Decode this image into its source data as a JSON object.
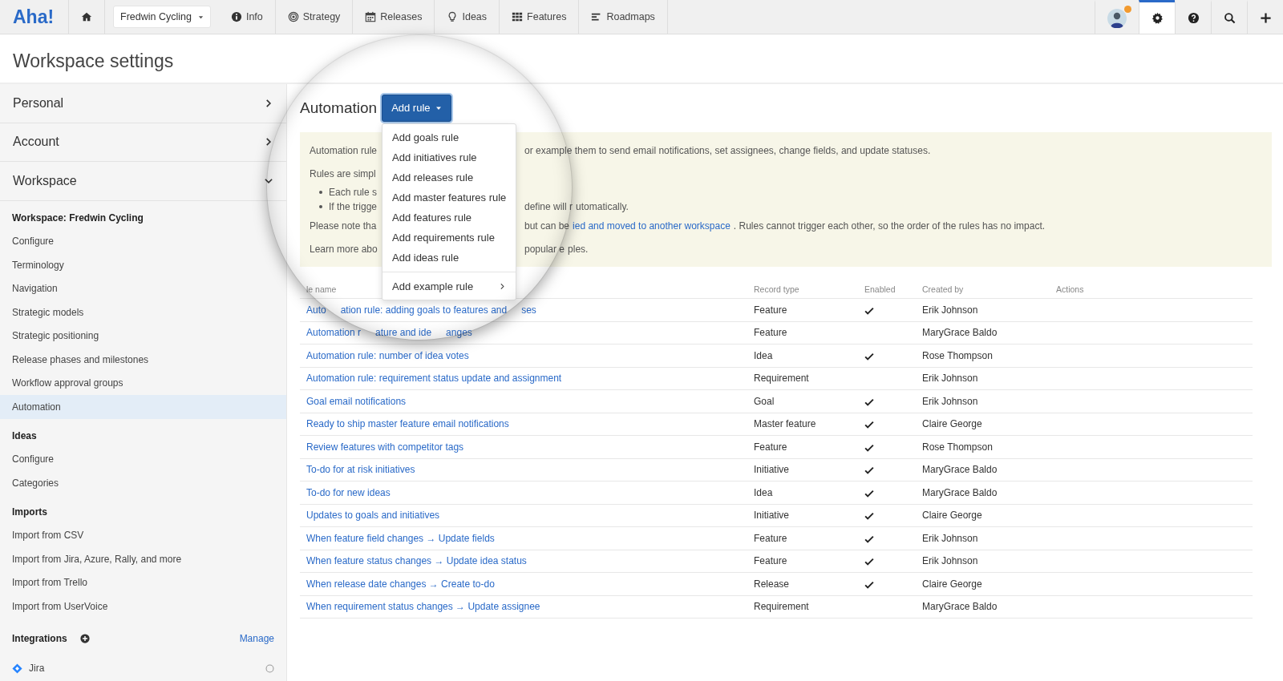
{
  "app": {
    "logo": "Aha!"
  },
  "nav": {
    "workspace_select": "Fredwin Cycling",
    "items": [
      {
        "kind": "home"
      },
      {
        "kind": "info",
        "label": "Info"
      },
      {
        "kind": "strategy",
        "label": "Strategy"
      },
      {
        "kind": "releases",
        "label": "Releases"
      },
      {
        "kind": "ideas",
        "label": "Ideas"
      },
      {
        "kind": "features",
        "label": "Features"
      },
      {
        "kind": "roadmaps",
        "label": "Roadmaps"
      }
    ],
    "tools": [
      {
        "kind": "avatar",
        "selected": false
      },
      {
        "kind": "settings",
        "selected": true
      },
      {
        "kind": "help",
        "selected": false
      },
      {
        "kind": "search",
        "selected": false
      },
      {
        "kind": "add",
        "selected": false
      }
    ]
  },
  "page_title": "Workspace settings",
  "sidebar": {
    "groups": [
      {
        "label": "Personal",
        "expanded": false
      },
      {
        "label": "Account",
        "expanded": false
      },
      {
        "label": "Workspace",
        "expanded": true
      }
    ],
    "sections": [
      {
        "heading": "Workspace: Fredwin Cycling",
        "items": [
          {
            "label": "Configure",
            "selected": false
          },
          {
            "label": "Terminology",
            "selected": false
          },
          {
            "label": "Navigation",
            "selected": false
          },
          {
            "label": "Strategic models",
            "selected": false
          },
          {
            "label": "Strategic positioning",
            "selected": false
          },
          {
            "label": "Release phases and milestones",
            "selected": false
          },
          {
            "label": "Workflow approval groups",
            "selected": false
          },
          {
            "label": "Automation",
            "selected": true
          }
        ]
      },
      {
        "heading": "Ideas",
        "items": [
          {
            "label": "Configure",
            "selected": false
          },
          {
            "label": "Categories",
            "selected": false
          }
        ]
      },
      {
        "heading": "Imports",
        "items": [
          {
            "label": "Import from CSV",
            "selected": false
          },
          {
            "label": "Import from Jira, Azure, Rally, and more",
            "selected": false
          },
          {
            "label": "Import from Trello",
            "selected": false
          },
          {
            "label": "Import from UserVoice",
            "selected": false
          }
        ]
      }
    ],
    "integrations": {
      "heading": "Integrations",
      "action": "Manage",
      "items": [
        {
          "label": "Jira",
          "on": false
        }
      ]
    }
  },
  "content": {
    "heading": "Automation",
    "add_button": "Add rule",
    "menu": {
      "items": [
        "Add goals rule",
        "Add initiatives rule",
        "Add releases rule",
        "Add master features rule",
        "Add features rule",
        "Add requirements rule",
        "Add ideas rule"
      ],
      "submenu_item": "Add example rule"
    },
    "banner": {
      "lines": [
        {
          "kind": "para",
          "left": "Automation rule",
          "right": [
            {
              "text": "or example them to send email notifications, set assignees, change fields, and update statuses.",
              "link": false
            }
          ]
        },
        {
          "kind": "para",
          "left": "Rules are simpl"
        },
        {
          "kind": "bullet",
          "left": "Each rule s"
        },
        {
          "kind": "bullet",
          "left": "If the trigge",
          "right": [
            {
              "text": "define will r",
              "link": false
            },
            {
              "text": "utomatically.",
              "link": false
            }
          ]
        },
        {
          "kind": "para",
          "left": "Please note tha",
          "right": [
            {
              "text": "but can be",
              "link": false
            },
            {
              "text": "ied and moved to another workspace",
              "link": true
            },
            {
              "text": ". Rules cannot trigger each other, so the order of the rules has no impact.",
              "link": false
            }
          ]
        },
        {
          "kind": "para",
          "left": "Learn more abo",
          "right": [
            {
              "text": "popular e",
              "link": false
            },
            {
              "text": "ples.",
              "link": false
            }
          ]
        }
      ]
    },
    "table": {
      "columns": [
        "le name",
        "Record type",
        "Enabled",
        "Created by",
        "Actions"
      ],
      "rows": [
        {
          "name": [
            "Auto",
            "ation rule: adding goals to features and",
            "ses"
          ],
          "record_type": "Feature",
          "enabled": true,
          "created_by": "Erik Johnson"
        },
        {
          "name": [
            "Automation r",
            "ature and ide",
            "anges"
          ],
          "record_type": "Feature",
          "enabled": false,
          "created_by": "MaryGrace Baldo"
        },
        {
          "name": [
            "Automation rule: number of idea votes"
          ],
          "record_type": "Idea",
          "enabled": true,
          "created_by": "Rose Thompson"
        },
        {
          "name": [
            "Automation rule: requirement status update and assignment"
          ],
          "record_type": "Requirement",
          "enabled": false,
          "created_by": "Erik Johnson"
        },
        {
          "name": [
            "Goal email notifications"
          ],
          "record_type": "Goal",
          "enabled": true,
          "created_by": "Erik Johnson"
        },
        {
          "name": [
            "Ready to ship master feature email notifications"
          ],
          "record_type": "Master feature",
          "enabled": true,
          "created_by": "Claire George"
        },
        {
          "name": [
            "Review features with competitor tags"
          ],
          "record_type": "Feature",
          "enabled": true,
          "created_by": "Rose Thompson"
        },
        {
          "name": [
            "To-do for at risk initiatives"
          ],
          "record_type": "Initiative",
          "enabled": true,
          "created_by": "MaryGrace Baldo"
        },
        {
          "name": [
            "To-do for new ideas"
          ],
          "record_type": "Idea",
          "enabled": true,
          "created_by": "MaryGrace Baldo"
        },
        {
          "name": [
            "Updates to goals and initiatives"
          ],
          "record_type": "Initiative",
          "enabled": true,
          "created_by": "Claire George"
        },
        {
          "name": [
            "When feature field changes → Update fields"
          ],
          "record_type": "Feature",
          "enabled": true,
          "created_by": "Erik Johnson"
        },
        {
          "name": [
            "When feature status changes → Update idea status"
          ],
          "record_type": "Feature",
          "enabled": true,
          "created_by": "Erik Johnson"
        },
        {
          "name": [
            "When release date changes → Create to-do"
          ],
          "record_type": "Release",
          "enabled": true,
          "created_by": "Claire George"
        },
        {
          "name": [
            "When requirement status changes → Update assignee"
          ],
          "record_type": "Requirement",
          "enabled": false,
          "created_by": "MaryGrace Baldo"
        }
      ]
    }
  }
}
